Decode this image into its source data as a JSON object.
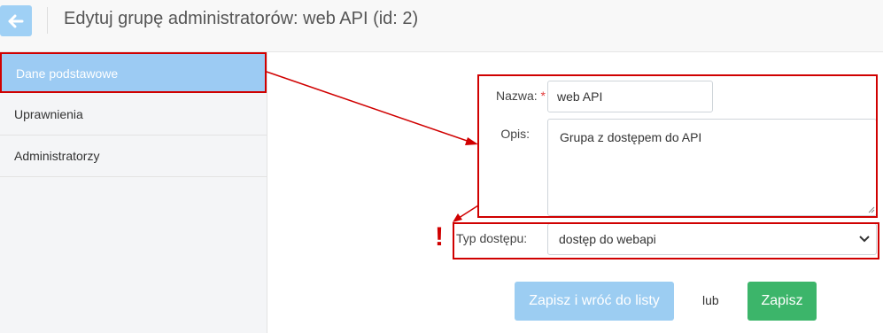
{
  "header": {
    "title": "Edytuj grupę administratorów: web API (id: 2)",
    "back_icon": "arrow-left-icon"
  },
  "sidebar": {
    "items": [
      {
        "label": "Dane podstawowe",
        "active": true
      },
      {
        "label": "Uprawnienia",
        "active": false
      },
      {
        "label": "Administratorzy",
        "active": false
      }
    ]
  },
  "form": {
    "name_label": "Nazwa:",
    "required_mark": "*",
    "name_value": "web API",
    "desc_label": "Opis:",
    "desc_value": "Grupa z dostępem do API",
    "access_label": "Typ dostępu:",
    "access_value": "dostęp do webapi"
  },
  "actions": {
    "save_back_label": "Zapisz i wróć do listy",
    "or_label": "lub",
    "save_label": "Zapisz"
  },
  "annotations": {
    "exclamation": "!",
    "highlight_color": "#d00000"
  }
}
